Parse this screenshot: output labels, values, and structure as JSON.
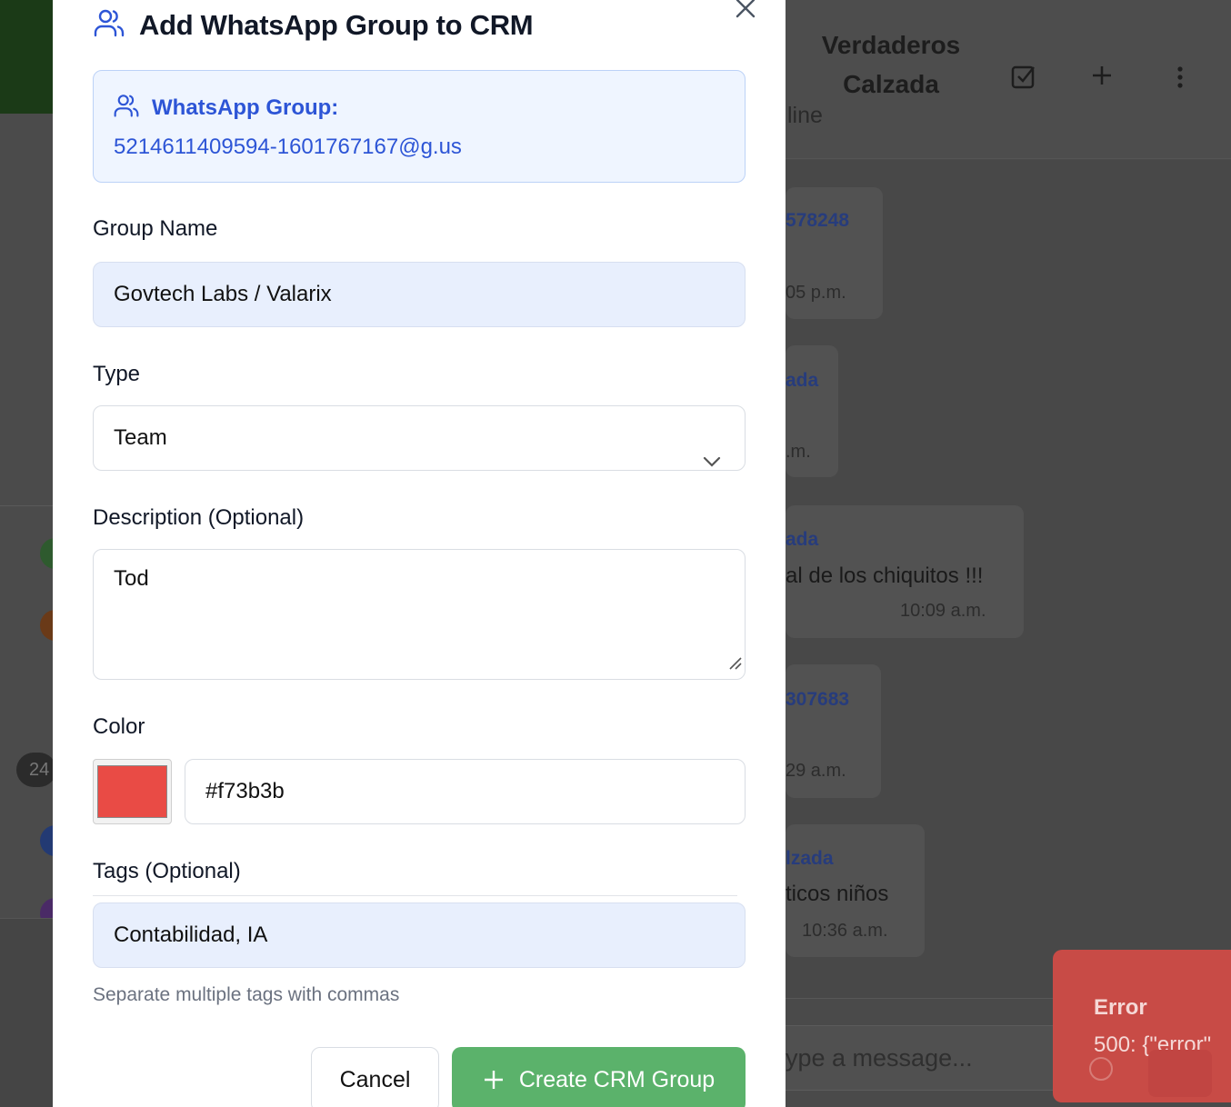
{
  "modal": {
    "title": "Add WhatsApp Group to CRM",
    "group_info": {
      "label": "WhatsApp Group:",
      "id": "5214611409594-1601767167@g.us"
    },
    "group_name": {
      "label": "Group Name",
      "value": "Govtech Labs / Valarix"
    },
    "type": {
      "label": "Type",
      "value": "Team"
    },
    "description": {
      "label": "Description (Optional)",
      "value": "Tod"
    },
    "color": {
      "label": "Color",
      "value": "#f73b3b",
      "swatch": "#e94b45"
    },
    "tags": {
      "label": "Tags (Optional)",
      "value": "Contabilidad, IA",
      "help": "Separate multiple tags with commas"
    },
    "buttons": {
      "cancel": "Cancel",
      "create": "Create CRM Group"
    }
  },
  "background": {
    "chat_title": "Verdaderos Calzada",
    "status": "line",
    "badge": "24",
    "messages": [
      {
        "sender": "578248",
        "text": "",
        "time": "05 p.m."
      },
      {
        "sender": "ada",
        "text": "",
        "time": ".m."
      },
      {
        "sender": "ada",
        "text": "al de los chiquitos !!!",
        "time": "10:09 a.m."
      },
      {
        "sender": "307683",
        "text": "",
        "time": "29 a.m."
      },
      {
        "sender": "lzada",
        "text": "ticos niños",
        "time": "10:36 a.m."
      }
    ],
    "composer_placeholder": "ype a message..."
  },
  "toast": {
    "title": "Error",
    "message": "500: {\"error\""
  },
  "colors": {
    "accent_blue": "#2d55d6",
    "primary_green": "#5bb26b",
    "error_red": "#c84b46"
  }
}
